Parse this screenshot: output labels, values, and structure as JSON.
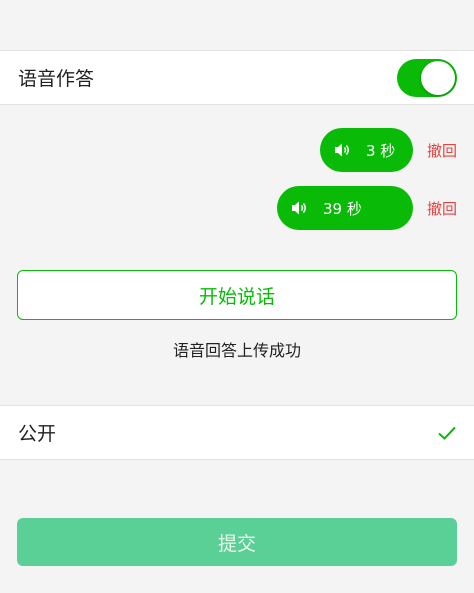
{
  "colors": {
    "accent": "#09bb07",
    "danger": "#e64340",
    "submit_bg": "#5acf96"
  },
  "voice_toggle": {
    "label": "语音作答",
    "on": true
  },
  "recordings": [
    {
      "duration": "3 秒",
      "recall_label": "撤回",
      "icon": "speaker-icon"
    },
    {
      "duration": "39 秒",
      "recall_label": "撤回",
      "icon": "speaker-icon"
    }
  ],
  "start_button": {
    "label": "开始说话"
  },
  "upload_status": "语音回答上传成功",
  "visibility": {
    "label": "公开",
    "checked": true,
    "icon": "check-icon"
  },
  "submit_button": {
    "label": "提交"
  }
}
